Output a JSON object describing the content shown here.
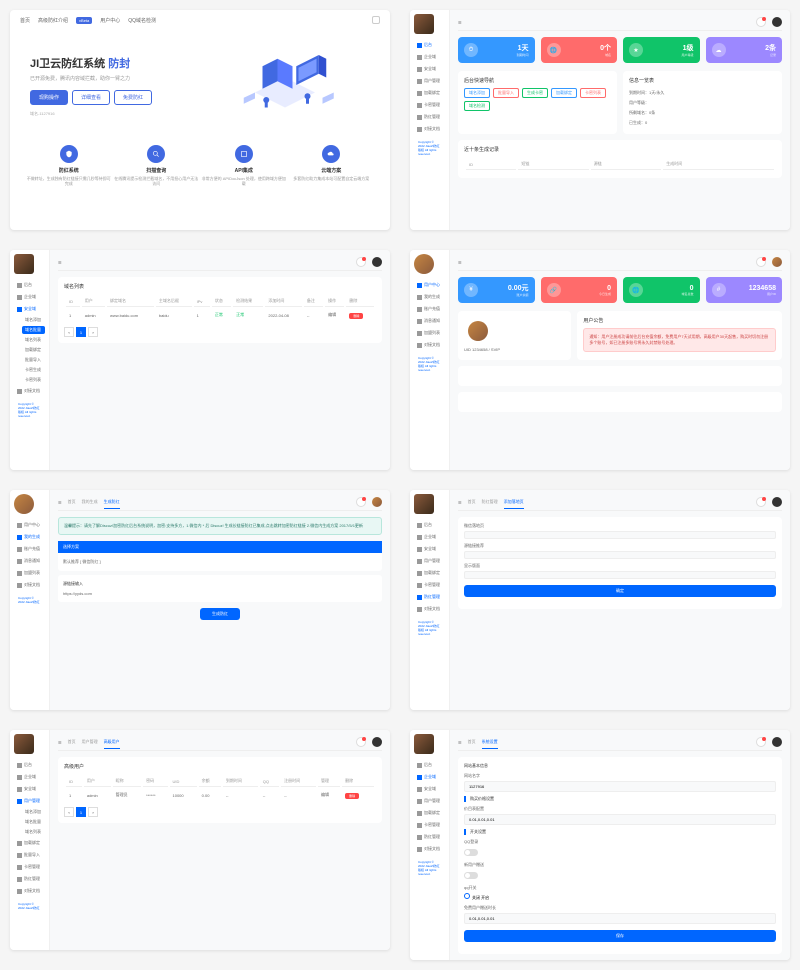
{
  "landing": {
    "nav": [
      "首页",
      "高级防红介绍",
      "用户中心",
      "QQ域名检测"
    ],
    "badge": "vBeta",
    "title_prefix": "JI卫云防红系统",
    "title_accent": "防封",
    "subtitle": "已开源免费，腾讯内容域拦截，助你一臂之力",
    "btn_primary": "现购操作",
    "btn_outline1": "详细查看",
    "btn_outline2": "免费防红",
    "note": "域名-1127916",
    "features": [
      {
        "title": "防红系统",
        "desc": "不做转址，生成独有防红链接只需几秒等待即可完成"
      },
      {
        "title": "扫描查询",
        "desc": "在线腾讯提示检测拦截域名，不用担心用户无法访问"
      },
      {
        "title": "API集成",
        "desc": "非常方便的 APIDocJson 处理，使用跨域方便加载"
      },
      {
        "title": "云端方案",
        "desc": "多套防红助力集成本站可配置自定云端方案"
      }
    ]
  },
  "dash1": {
    "nav": [
      "后台",
      "企业域",
      "安全域",
      "用户管理",
      "加载绑定",
      "卡密管理",
      "防红管理",
      "对接文档"
    ],
    "cards": [
      {
        "val": "1天",
        "lbl": "到期时间"
      },
      {
        "val": "0个",
        "lbl": "域名"
      },
      {
        "val": "1级",
        "lbl": "用户等级"
      },
      {
        "val": "2条",
        "lbl": "记录"
      }
    ],
    "panel1_title": "后台快速导航",
    "tags": [
      "域名添加",
      "批量导入",
      "生成卡密",
      "加载绑定",
      "卡密列表",
      "域名检测"
    ],
    "panel2_title": "信息一览表",
    "info": [
      "到期时间：1天/永久",
      "用户等级：",
      "所剩域名：0条",
      "已生成：0"
    ],
    "panel3_title": "近十条生成记录",
    "cols": [
      "ID",
      "短链",
      "源链",
      "生成时间"
    ]
  },
  "dash2": {
    "nav": [
      "后台",
      "企业域",
      "安全域",
      "用户管理",
      "加载绑定",
      "卡密管理",
      "防红管理",
      "对接文档"
    ],
    "submenu": [
      "域名添加",
      "域名批量",
      "域名列表",
      "加载绑定",
      "批量导入",
      "卡密生成",
      "卡密列表"
    ],
    "panel_title": "域名列表",
    "cols": [
      "ID",
      "用户",
      "绑定域名",
      "主域名后缀",
      "IPv",
      "状态",
      "检测结果",
      "添加时间",
      "备注",
      "操作",
      "删除"
    ],
    "row": [
      "1",
      "admin",
      "www.baidu.com",
      "baidu",
      "1",
      "正常",
      "正常",
      "2022-04-08",
      "--",
      "编辑"
    ],
    "del": "删除"
  },
  "dash3": {
    "nav": [
      "用户中心",
      "我的生成",
      "账户充值",
      "消息通知",
      "加盟列表",
      "对接文档"
    ],
    "cards": [
      {
        "val": "0.00元",
        "lbl": "账户余额"
      },
      {
        "val": "0",
        "lbl": "今日生成"
      },
      {
        "val": "0",
        "lbl": "域名总数"
      },
      {
        "val": "1234658",
        "lbl": "用户ID"
      }
    ],
    "user_id": "UID 1234658 / SVIP",
    "panel_title": "用户公告",
    "alert": "通知：用户注册成功请前往后台充值余额，免费用户7天试用期，高级用户30天起售，购买时切勿注册多个账号，如已注册多账号将永久封禁账号处理。"
  },
  "dash4": {
    "nav": [
      "用户中心",
      "我的生成",
      "账户充值",
      "消息通知",
      "加盟列表",
      "对接文档"
    ],
    "tabs": [
      "首页",
      "我的生成",
      "生成防红"
    ],
    "alert": "温馨提示：请先了解Discuz!加密防红后台系统说明，加密:支持多方，1.微信内 * 后 Discuz! 生成长链接防红已集成,点击跳转加密防红链接 2.微信内生成方案 2017/5/1更新",
    "hdr1": "选择方案",
    "line1": "默认推荐 [ 微信防红 ]",
    "hdr2": "源链接输入",
    "line2": "https://yyds.com",
    "btn": "生成防红"
  },
  "dash5": {
    "nav": [
      "后台",
      "企业域",
      "安全域",
      "用户管理",
      "加载绑定",
      "卡密管理",
      "防红管理",
      "对接文档"
    ],
    "tabs": [
      "首页",
      "防红管理",
      "添加落地页"
    ],
    "fields": [
      "微信落地页",
      "源链接推荐",
      "显示版面"
    ],
    "placeholder": "请输入...",
    "btn": "确定"
  },
  "dash6": {
    "nav": [
      "后台",
      "企业域",
      "安全域",
      "用户管理",
      "域名添加",
      "域名批量",
      "域名列表",
      "加载绑定",
      "批量导入",
      "卡密管理",
      "卡密生成",
      "卡密列表",
      "防红管理",
      "对接文档"
    ],
    "tabs": [
      "首页",
      "用户管理",
      "高级用户"
    ],
    "panel_title": "高级用户",
    "cols": [
      "ID",
      "用户",
      "昵称",
      "密码",
      "UID",
      "余额",
      "到期时间",
      "QQ",
      "注册时间",
      "管理",
      "删除"
    ],
    "row": [
      "1",
      "admin",
      "管理员",
      "******",
      "10000",
      "0.00",
      "--",
      "--",
      "--",
      "编辑"
    ]
  },
  "dash7": {
    "nav": [
      "后台",
      "企业域",
      "安全域",
      "用户管理",
      "加载绑定",
      "卡密管理",
      "防红管理",
      "对接文档"
    ],
    "tabs": [
      "首页",
      "系统设置"
    ],
    "sections": [
      "网站基本信息",
      "网站名字",
      "1127916",
      "",
      "购买价格设置",
      "价目表配置",
      "0.01,0.01,0.01",
      "",
      "开关设置",
      "QQ登录",
      "新用户赠送",
      "前台开关:",
      "qq开关",
      "关闭 开启",
      "免费用户赠送时长",
      "0.01,0.01,0.01"
    ],
    "btn": "保存"
  },
  "topbar_tabs": [
    "首页"
  ],
  "hamburger": "☰"
}
